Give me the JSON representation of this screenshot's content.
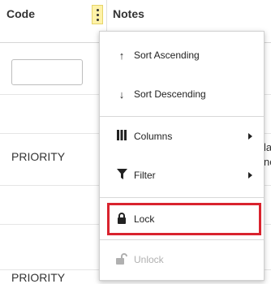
{
  "header": {
    "code_label": "Code",
    "notes_label": "Notes"
  },
  "rows": {
    "row3_text": "PRIORITY",
    "row6_text": "PRIORITY",
    "row3_notes_partial_1": "la",
    "row3_notes_partial_2": "no"
  },
  "context_menu": {
    "sort_asc": "Sort Ascending",
    "sort_desc": "Sort Descending",
    "columns": "Columns",
    "filter": "Filter",
    "lock": "Lock",
    "unlock": "Unlock"
  },
  "icons": {
    "sort_asc": "arrow-up-icon",
    "sort_desc": "arrow-down-icon",
    "columns": "columns-icon",
    "filter": "filter-icon",
    "lock": "lock-icon",
    "unlock": "unlock-icon",
    "kebab": "kebab-icon"
  },
  "colors": {
    "highlight": "#d9232e",
    "kebab_bg": "#fff2a8"
  }
}
